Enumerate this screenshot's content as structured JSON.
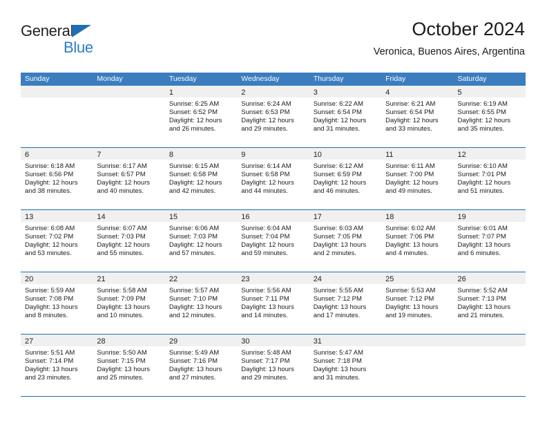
{
  "brand": {
    "name_part1": "General",
    "name_part2": "Blue",
    "logo_icon": "triangle-flag-icon",
    "accent_color": "#2b7cc4"
  },
  "header": {
    "title": "October 2024",
    "subtitle": "Veronica, Buenos Aires, Argentina"
  },
  "calendar": {
    "header_bg": "#3b7dbf",
    "weekday_headers": [
      "Sunday",
      "Monday",
      "Tuesday",
      "Wednesday",
      "Thursday",
      "Friday",
      "Saturday"
    ],
    "weeks": [
      [
        {
          "day": "",
          "lines": []
        },
        {
          "day": "",
          "lines": []
        },
        {
          "day": "1",
          "lines": [
            "Sunrise: 6:25 AM",
            "Sunset: 6:52 PM",
            "Daylight: 12 hours",
            "and 26 minutes."
          ]
        },
        {
          "day": "2",
          "lines": [
            "Sunrise: 6:24 AM",
            "Sunset: 6:53 PM",
            "Daylight: 12 hours",
            "and 29 minutes."
          ]
        },
        {
          "day": "3",
          "lines": [
            "Sunrise: 6:22 AM",
            "Sunset: 6:54 PM",
            "Daylight: 12 hours",
            "and 31 minutes."
          ]
        },
        {
          "day": "4",
          "lines": [
            "Sunrise: 6:21 AM",
            "Sunset: 6:54 PM",
            "Daylight: 12 hours",
            "and 33 minutes."
          ]
        },
        {
          "day": "5",
          "lines": [
            "Sunrise: 6:19 AM",
            "Sunset: 6:55 PM",
            "Daylight: 12 hours",
            "and 35 minutes."
          ]
        }
      ],
      [
        {
          "day": "6",
          "lines": [
            "Sunrise: 6:18 AM",
            "Sunset: 6:56 PM",
            "Daylight: 12 hours",
            "and 38 minutes."
          ]
        },
        {
          "day": "7",
          "lines": [
            "Sunrise: 6:17 AM",
            "Sunset: 6:57 PM",
            "Daylight: 12 hours",
            "and 40 minutes."
          ]
        },
        {
          "day": "8",
          "lines": [
            "Sunrise: 6:15 AM",
            "Sunset: 6:58 PM",
            "Daylight: 12 hours",
            "and 42 minutes."
          ]
        },
        {
          "day": "9",
          "lines": [
            "Sunrise: 6:14 AM",
            "Sunset: 6:58 PM",
            "Daylight: 12 hours",
            "and 44 minutes."
          ]
        },
        {
          "day": "10",
          "lines": [
            "Sunrise: 6:12 AM",
            "Sunset: 6:59 PM",
            "Daylight: 12 hours",
            "and 46 minutes."
          ]
        },
        {
          "day": "11",
          "lines": [
            "Sunrise: 6:11 AM",
            "Sunset: 7:00 PM",
            "Daylight: 12 hours",
            "and 49 minutes."
          ]
        },
        {
          "day": "12",
          "lines": [
            "Sunrise: 6:10 AM",
            "Sunset: 7:01 PM",
            "Daylight: 12 hours",
            "and 51 minutes."
          ]
        }
      ],
      [
        {
          "day": "13",
          "lines": [
            "Sunrise: 6:08 AM",
            "Sunset: 7:02 PM",
            "Daylight: 12 hours",
            "and 53 minutes."
          ]
        },
        {
          "day": "14",
          "lines": [
            "Sunrise: 6:07 AM",
            "Sunset: 7:03 PM",
            "Daylight: 12 hours",
            "and 55 minutes."
          ]
        },
        {
          "day": "15",
          "lines": [
            "Sunrise: 6:06 AM",
            "Sunset: 7:03 PM",
            "Daylight: 12 hours",
            "and 57 minutes."
          ]
        },
        {
          "day": "16",
          "lines": [
            "Sunrise: 6:04 AM",
            "Sunset: 7:04 PM",
            "Daylight: 12 hours",
            "and 59 minutes."
          ]
        },
        {
          "day": "17",
          "lines": [
            "Sunrise: 6:03 AM",
            "Sunset: 7:05 PM",
            "Daylight: 13 hours",
            "and 2 minutes."
          ]
        },
        {
          "day": "18",
          "lines": [
            "Sunrise: 6:02 AM",
            "Sunset: 7:06 PM",
            "Daylight: 13 hours",
            "and 4 minutes."
          ]
        },
        {
          "day": "19",
          "lines": [
            "Sunrise: 6:01 AM",
            "Sunset: 7:07 PM",
            "Daylight: 13 hours",
            "and 6 minutes."
          ]
        }
      ],
      [
        {
          "day": "20",
          "lines": [
            "Sunrise: 5:59 AM",
            "Sunset: 7:08 PM",
            "Daylight: 13 hours",
            "and 8 minutes."
          ]
        },
        {
          "day": "21",
          "lines": [
            "Sunrise: 5:58 AM",
            "Sunset: 7:09 PM",
            "Daylight: 13 hours",
            "and 10 minutes."
          ]
        },
        {
          "day": "22",
          "lines": [
            "Sunrise: 5:57 AM",
            "Sunset: 7:10 PM",
            "Daylight: 13 hours",
            "and 12 minutes."
          ]
        },
        {
          "day": "23",
          "lines": [
            "Sunrise: 5:56 AM",
            "Sunset: 7:11 PM",
            "Daylight: 13 hours",
            "and 14 minutes."
          ]
        },
        {
          "day": "24",
          "lines": [
            "Sunrise: 5:55 AM",
            "Sunset: 7:12 PM",
            "Daylight: 13 hours",
            "and 17 minutes."
          ]
        },
        {
          "day": "25",
          "lines": [
            "Sunrise: 5:53 AM",
            "Sunset: 7:12 PM",
            "Daylight: 13 hours",
            "and 19 minutes."
          ]
        },
        {
          "day": "26",
          "lines": [
            "Sunrise: 5:52 AM",
            "Sunset: 7:13 PM",
            "Daylight: 13 hours",
            "and 21 minutes."
          ]
        }
      ],
      [
        {
          "day": "27",
          "lines": [
            "Sunrise: 5:51 AM",
            "Sunset: 7:14 PM",
            "Daylight: 13 hours",
            "and 23 minutes."
          ]
        },
        {
          "day": "28",
          "lines": [
            "Sunrise: 5:50 AM",
            "Sunset: 7:15 PM",
            "Daylight: 13 hours",
            "and 25 minutes."
          ]
        },
        {
          "day": "29",
          "lines": [
            "Sunrise: 5:49 AM",
            "Sunset: 7:16 PM",
            "Daylight: 13 hours",
            "and 27 minutes."
          ]
        },
        {
          "day": "30",
          "lines": [
            "Sunrise: 5:48 AM",
            "Sunset: 7:17 PM",
            "Daylight: 13 hours",
            "and 29 minutes."
          ]
        },
        {
          "day": "31",
          "lines": [
            "Sunrise: 5:47 AM",
            "Sunset: 7:18 PM",
            "Daylight: 13 hours",
            "and 31 minutes."
          ]
        },
        {
          "day": "",
          "lines": []
        },
        {
          "day": "",
          "lines": []
        }
      ]
    ]
  }
}
